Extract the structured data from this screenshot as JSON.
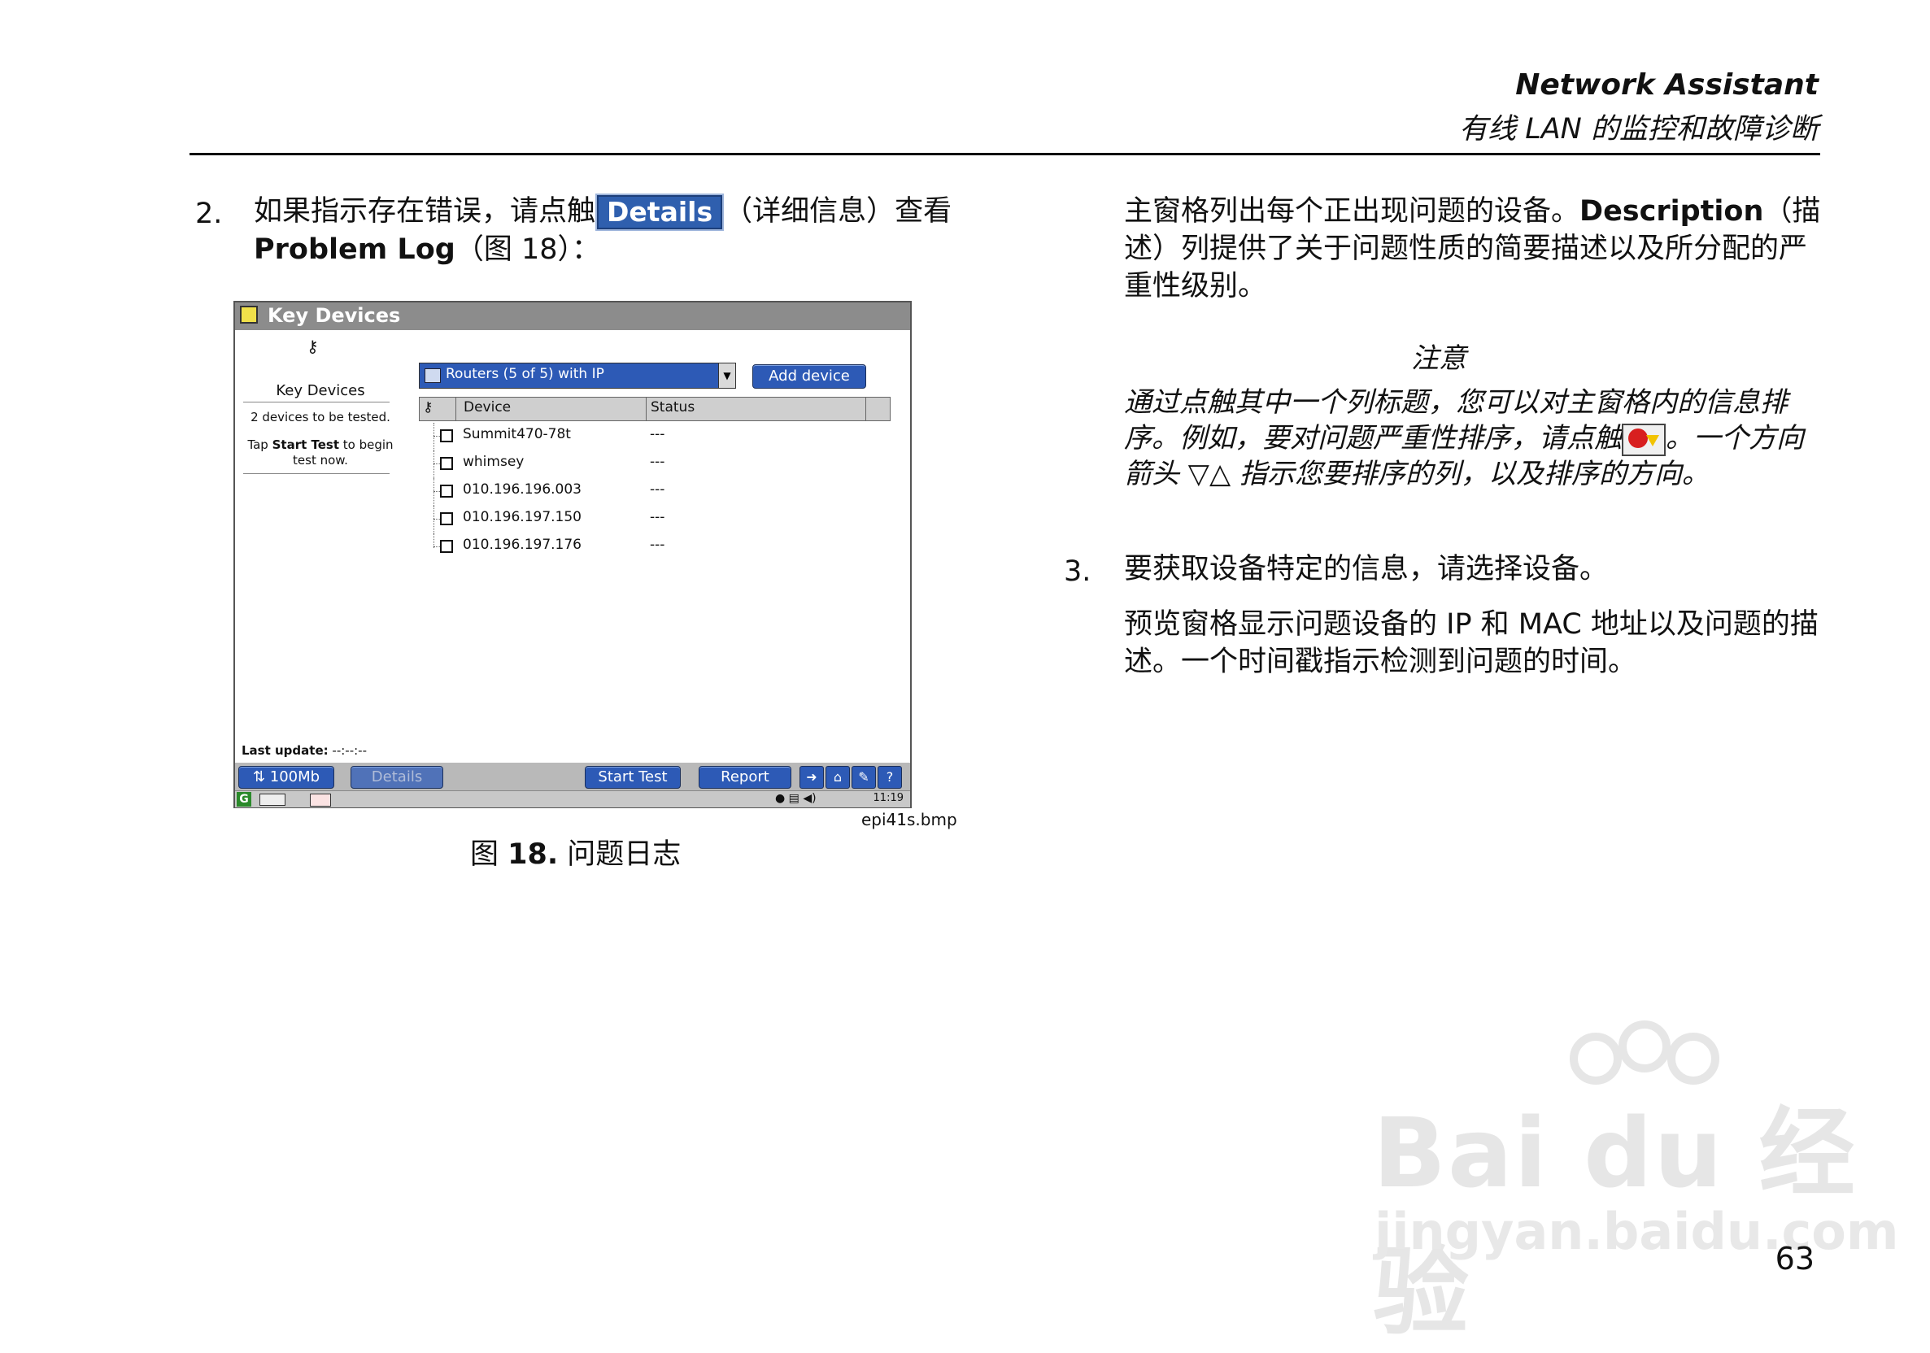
{
  "header": {
    "title": "Network Assistant",
    "subtitle": "有线 LAN 的监控和故障诊断"
  },
  "step2": {
    "number": "2.",
    "text_before": "如果指示存在错误，请点触",
    "details_button_label": "Details",
    "text_after": "（详细信息）查看",
    "problem_log": "Problem Log",
    "figure_ref": "（图 18）："
  },
  "device": {
    "window_title": "Key Devices",
    "left_pane": {
      "heading": "Key Devices",
      "count_text": "2 devices to be tested.",
      "hint_line1_pre": "Tap ",
      "hint_bold": "Start Test",
      "hint_line1_post": " to begin",
      "hint_line2": "test now.",
      "last_update_label": "Last update:",
      "last_update_value": "--:--:--"
    },
    "dropdown_value": "Routers (5 of 5) with IP",
    "add_device_label": "Add device",
    "columns": {
      "device": "Device",
      "status": "Status"
    },
    "rows": [
      {
        "name": "Summit470-78t",
        "status": "---"
      },
      {
        "name": "whimsey",
        "status": "---"
      },
      {
        "name": "010.196.196.003",
        "status": "---"
      },
      {
        "name": "010.196.197.150",
        "status": "---"
      },
      {
        "name": "010.196.197.176",
        "status": "---"
      }
    ],
    "toolbar": {
      "speed_label": "100Mb",
      "details_label": "Details",
      "start_test_label": "Start Test",
      "report_label": "Report"
    },
    "clock": "11:19"
  },
  "figure": {
    "file": "epi41s.bmp",
    "caption_prefix": "图 ",
    "caption_num": "18.",
    "caption_text": " 问题日志"
  },
  "right": {
    "para1_a": "主窗格列出每个正出现问题的设备。",
    "para1_bold": "Description",
    "para1_b": "（描述）列提供了关于问题性质的简要描述以及所分配的严重性级别。",
    "note_title": "注意",
    "note_a": "通过点触其中一个列标题，您可以对主窗格内的信息排序。例如，要对问题严重性排序，请点触",
    "note_b": "。一个方向箭头 ▽△ 指示您要排序的列，以及排序的方向。",
    "step3_num": "3.",
    "step3_text": "要获取设备特定的信息，请选择设备。",
    "para2": "预览窗格显示问题设备的 IP 和 MAC 地址以及问题的描述。一个时间戳指示检测到问题的时间。"
  },
  "watermark": {
    "main": "Bai du 经验",
    "sub": "jingyan.baidu.com"
  },
  "page_number": "63"
}
